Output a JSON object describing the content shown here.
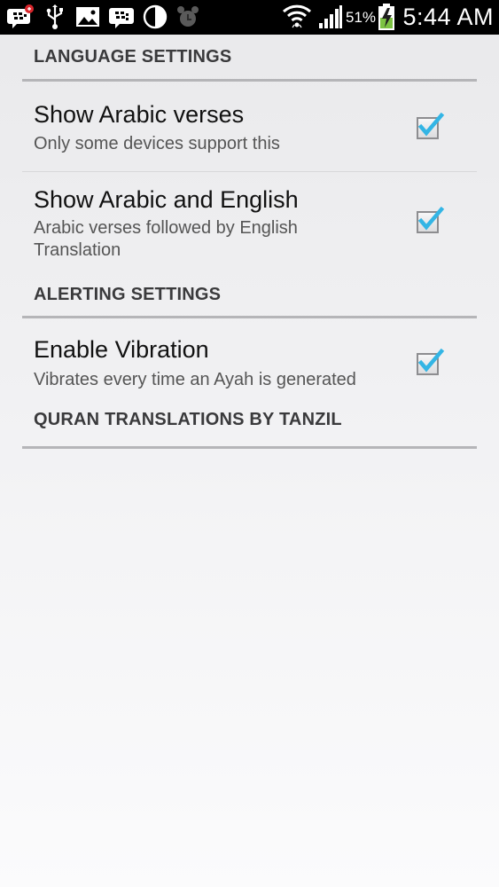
{
  "status_bar": {
    "battery_percent": "51%",
    "time": "5:44 AM",
    "notification_icons": [
      "bbm-icon",
      "usb-icon",
      "gallery-icon",
      "bbm-chat-icon",
      "night-mode-icon",
      "alarm-icon"
    ],
    "system_icons": [
      "wifi-icon",
      "signal-icon",
      "battery-charging-icon"
    ]
  },
  "settings": {
    "language_header": "LANGUAGE SETTINGS",
    "show_arabic": {
      "title": "Show Arabic verses",
      "summary": "Only some devices support this",
      "checked": true
    },
    "show_arabic_english": {
      "title": "Show Arabic and English",
      "summary": "Arabic verses followed by English Translation",
      "checked": true
    },
    "alerting_header": "ALERTING SETTINGS",
    "enable_vibration": {
      "title": "Enable Vibration",
      "summary": "Vibrates every time an Ayah is generated",
      "checked": true
    },
    "translations_header": "QURAN TRANSLATIONS BY TANZIL"
  },
  "colors": {
    "check_accent": "#33b5e5",
    "status_bar_bg": "#000000",
    "battery_green": "#7cc242",
    "badge_red": "#d9262c"
  }
}
